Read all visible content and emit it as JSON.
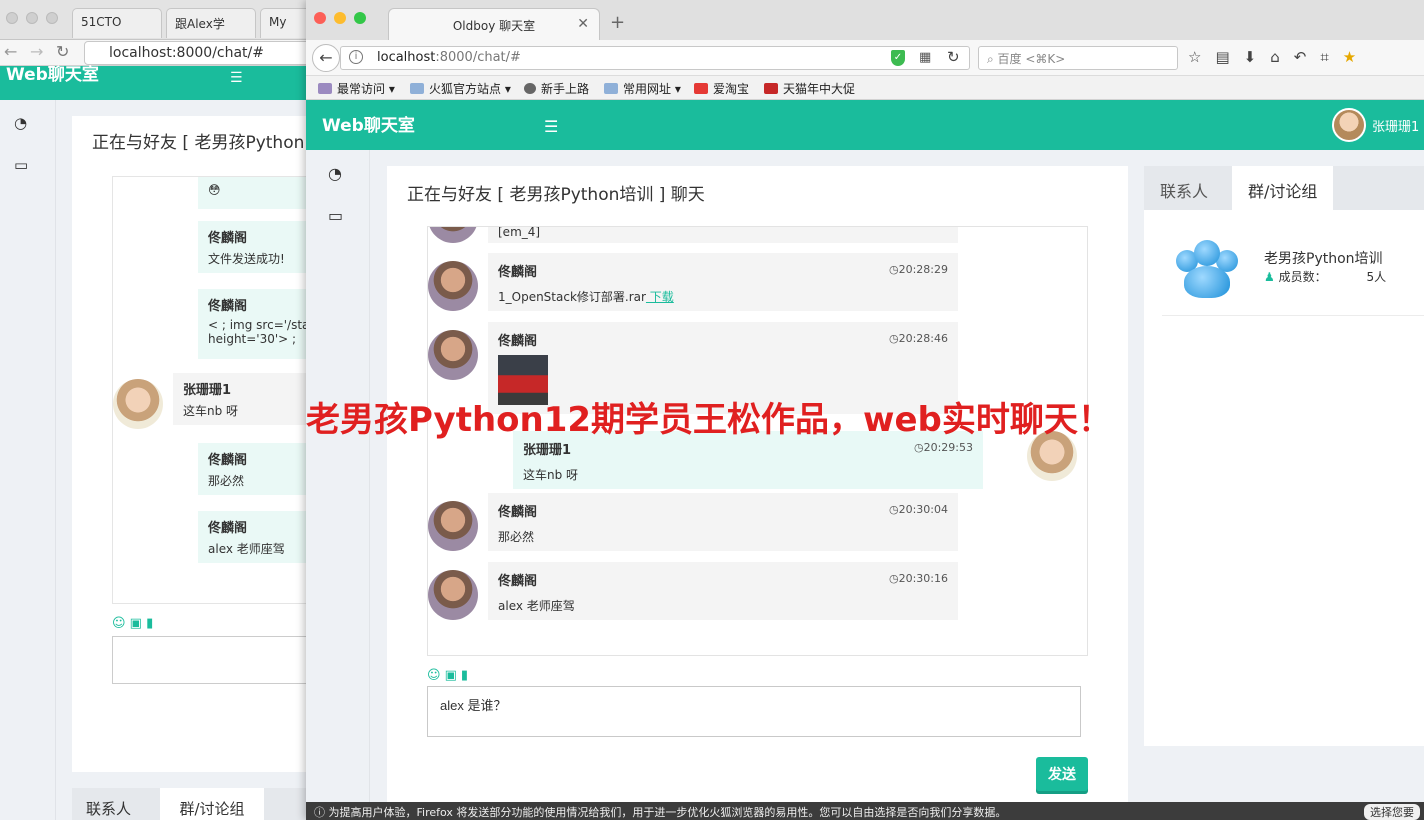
{
  "background_window": {
    "tabs": [
      "51CTO",
      "跟Alex学",
      "My"
    ],
    "url": "localhost:8000/chat/#",
    "brand": "Web聊天室",
    "title": "正在与好友 [ 老男孩Python",
    "messages": [
      {
        "name": "佟麟阁",
        "text": "文件发送成功!"
      },
      {
        "name": "佟麟阁",
        "text": "< ; img src='/sta height='30'> ;"
      },
      {
        "name": "张珊珊1",
        "text": "这车nb 呀"
      },
      {
        "name": "佟麟阁",
        "text": "那必然"
      },
      {
        "name": "佟麟阁",
        "text": "alex 老师座驾"
      }
    ],
    "bottom_tabs": [
      "联系人",
      "群/讨论组"
    ]
  },
  "browser": {
    "tab_title": "Oldboy 聊天室",
    "url_host": "localhost",
    "url_path": ":8000/chat/#",
    "search_placeholder": "百度 <⌘K>",
    "bookmarks": [
      "最常访问",
      "火狐官方站点",
      "新手上路",
      "常用网址",
      "爱淘宝",
      "天猫年中大促"
    ],
    "notice": "为提高用户体验，Firefox 将发送部分功能的使用情况给我们，用于进一步优化火狐浏览器的易用性。您可以自由选择是否向我们分享数据。",
    "notice_button": "选择您要"
  },
  "app": {
    "brand": "Web聊天室",
    "menu_icon": "bars-icon",
    "username": "张珊珊1",
    "side_icons": [
      "dashboard-icon",
      "desktop-icon"
    ]
  },
  "chat": {
    "title": "正在与好友 [ 老男孩Python培训 ] 聊天",
    "partial_top": "[em_4]",
    "messages": [
      {
        "name": "佟麟阁",
        "time": "◷20:28:29",
        "text": "1_OpenStack修订部署.rar",
        "link": " 下载"
      },
      {
        "name": "佟麟阁",
        "time": "◷20:28:46",
        "text": ""
      },
      {
        "name": "张珊珊1",
        "time": "◷20:29:53",
        "text": "这车nb 呀"
      },
      {
        "name": "佟麟阁",
        "time": "◷20:30:04",
        "text": "那必然"
      },
      {
        "name": "佟麟阁",
        "time": "◷20:30:16",
        "text": "alex 老师座驾"
      }
    ],
    "input_value": "alex 是谁？",
    "send_label": "发送"
  },
  "contacts": {
    "tabs": [
      "联系人",
      "群/讨论组"
    ],
    "active_tab": 1,
    "group_name": "老男孩Python培训",
    "members_label": "成员数：",
    "members_count": "5人"
  },
  "overlay_caption": "老男孩Python12期学员王松作品，web实时聊天！",
  "colors": {
    "accent": "#1abc9c",
    "caption": "#e02020"
  }
}
